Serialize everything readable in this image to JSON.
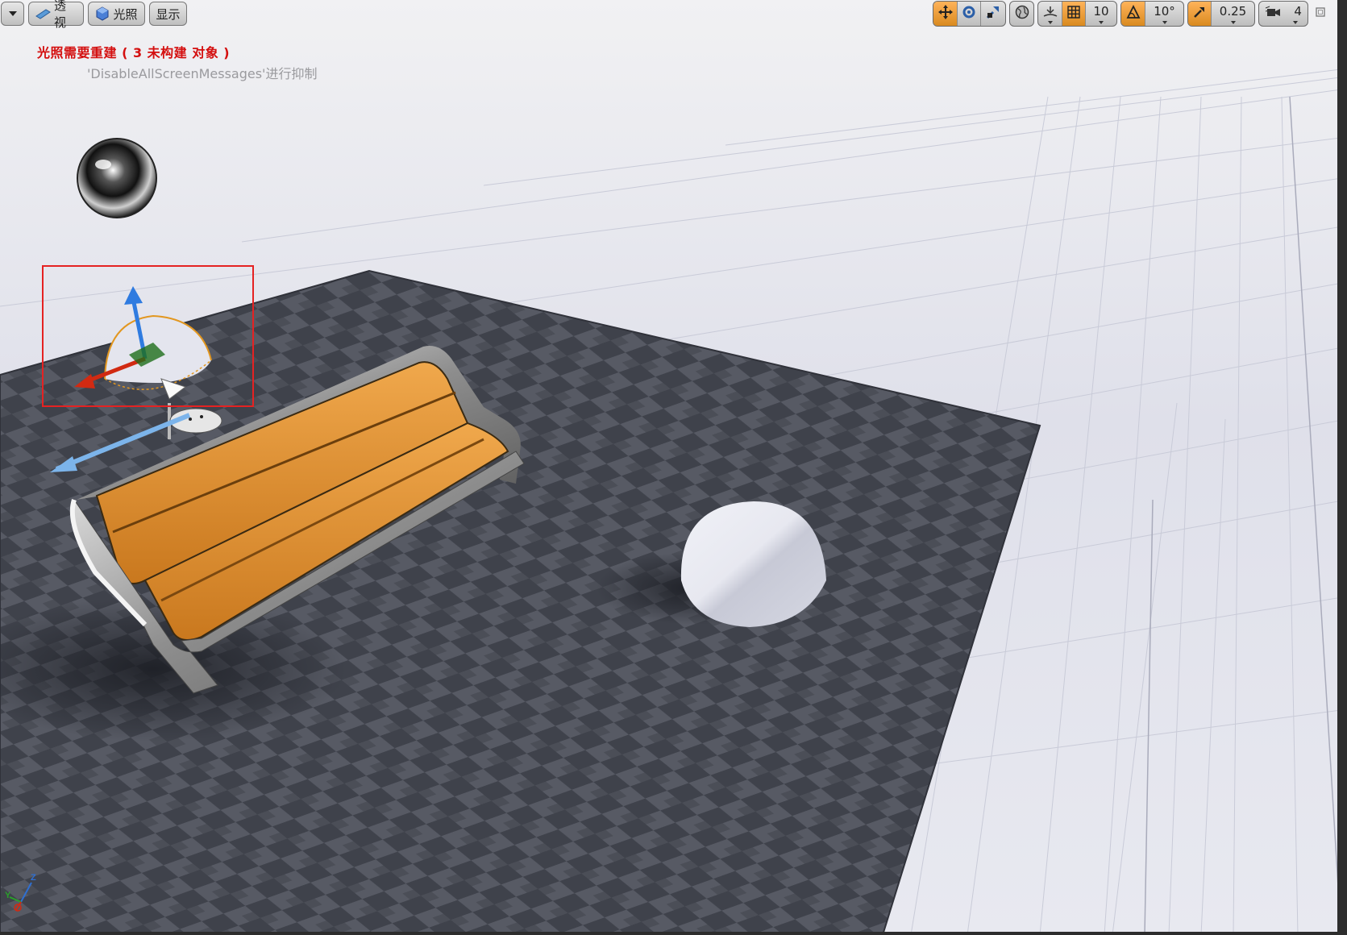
{
  "toolbar": {
    "menu_icon": "chevron-down-icon",
    "perspective_label": "透视",
    "lighting_label": "光照",
    "show_label": "显示",
    "grid_snap_value": "10",
    "rotation_snap_value": "10°",
    "scale_snap_value": "0.25",
    "camera_speed_value": "4",
    "accent_color": "#e8902e"
  },
  "messages": {
    "lighting_rebuild": "光照需要重建 ( 3 未构建 对象 )",
    "suppress_hint": "'DisableAllScreenMessages'进行抑制"
  },
  "axes": {
    "z_label": "Z",
    "y_label": "Y"
  },
  "scene": {
    "objects": [
      "reflection-sphere",
      "selected-light-actor",
      "player-start",
      "bench",
      "half-sphere",
      "checker-floor",
      "grid-plane"
    ],
    "selection_color": "#e52222",
    "bench_color": "#e2922f"
  }
}
